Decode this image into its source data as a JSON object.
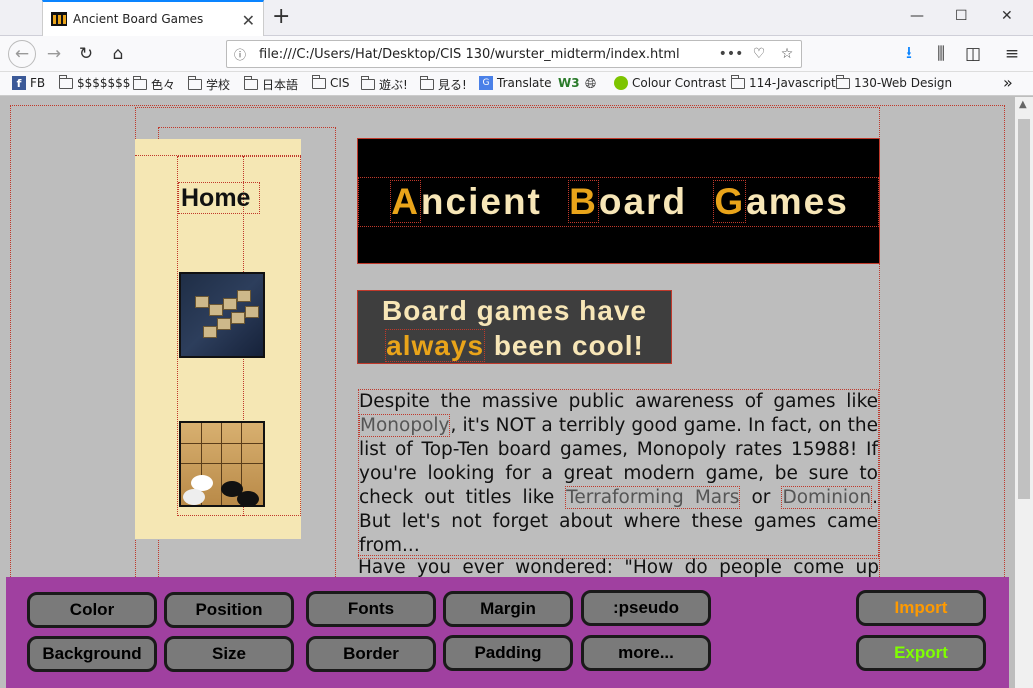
{
  "tab": {
    "title": "Ancient Board Games"
  },
  "nav": {
    "url": "file:///C:/Users/Hat/Desktop/CIS 130/wurster_midterm/index.html",
    "more": "•••"
  },
  "bookmarks": [
    {
      "label": "FB",
      "icon": "facebook-icon"
    },
    {
      "label": "$$$$$$$",
      "icon": "folder-icon"
    },
    {
      "label": "色々",
      "icon": "folder-icon"
    },
    {
      "label": "学校",
      "icon": "folder-icon"
    },
    {
      "label": "日本語",
      "icon": "folder-icon"
    },
    {
      "label": "CIS",
      "icon": "folder-icon"
    },
    {
      "label": "遊ぶ!",
      "icon": "folder-icon"
    },
    {
      "label": "見る!",
      "icon": "folder-icon"
    },
    {
      "label": "Translate",
      "icon": "translate-icon"
    },
    {
      "label": "W3",
      "icon": "w3-icon"
    },
    {
      "label": "",
      "icon": "globe-icon"
    },
    {
      "label": "Colour Contrast",
      "icon": "colour-contrast-icon"
    },
    {
      "label": "114-Javascript",
      "icon": "folder-icon"
    },
    {
      "label": "130-Web Design",
      "icon": "folder-icon"
    }
  ],
  "sidebar": {
    "home_label": "Home"
  },
  "header": {
    "title_parts": [
      {
        "cap": "A",
        "rest": "ncient"
      },
      {
        "cap": "B",
        "rest": "oard"
      },
      {
        "cap": "G",
        "rest": "ames"
      }
    ]
  },
  "banner": {
    "line1": "Board games have",
    "highlight": "always",
    "line2_rest": "been cool!"
  },
  "intro": {
    "p1": "Despite the massive public awareness of games like ",
    "link1": "Monopoly",
    "p2": ", it's NOT a terribly good game. In fact, on the list of Top-Ten board games, Monopoly rates 15988! If you're looking for a great modern game, be sure to check out titles like ",
    "link2": "Terraforming Mars",
    "p3": " or ",
    "link3": "Dominion",
    "p4": ". But let's not forget about where these games came from...",
    "next": "Have you ever wondered: \"How do people come up with"
  },
  "panel": {
    "row1": [
      "Color",
      "Position",
      "Fonts",
      "Margin",
      ":pseudo"
    ],
    "row2": [
      "Background",
      "Size",
      "Border",
      "Padding",
      "more..."
    ],
    "import": "Import",
    "export": "Export",
    "import_color": "#ff9a00",
    "export_color": "#7fff00"
  }
}
